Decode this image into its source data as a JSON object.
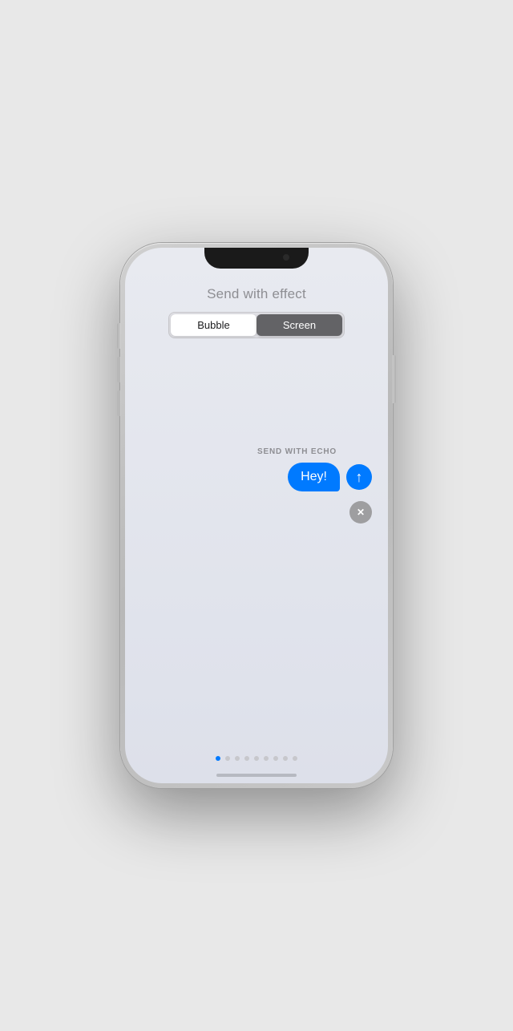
{
  "page": {
    "title": "Send with effect",
    "background_color": "#dde0ea"
  },
  "tabs": {
    "bubble_label": "Bubble",
    "screen_label": "Screen",
    "active_tab": "screen"
  },
  "echo_section": {
    "label": "SEND WITH ECHO",
    "message_text": "Hey!",
    "send_button_aria": "Send",
    "close_button_aria": "Cancel"
  },
  "page_dots": {
    "total": 9,
    "active_index": 0
  },
  "icons": {
    "send": "↑",
    "close": "✕"
  }
}
